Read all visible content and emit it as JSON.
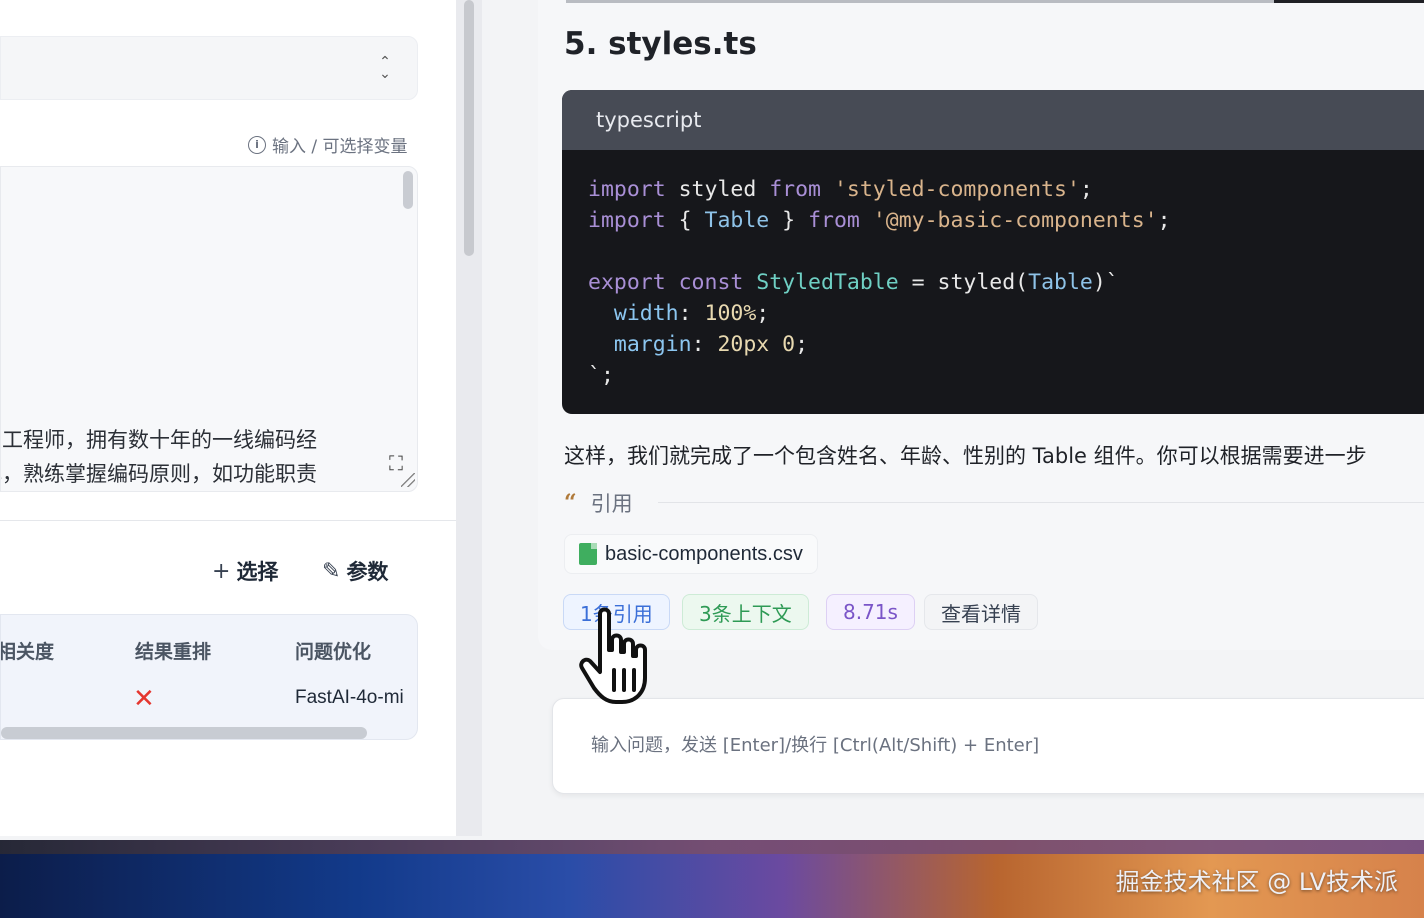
{
  "left_panel": {
    "prompt_hint": "输入 / 可选择变量",
    "prompt_lines": [
      "发工程师，拥有数十年的一线编码经",
      "解，熟练掌握编码原则，如功能职责"
    ],
    "actions": {
      "select_label": "选择",
      "params_label": "参数"
    },
    "table": {
      "headers": [
        "相关度",
        "结果重排",
        "问题优化"
      ],
      "row": {
        "rerank": "✕",
        "optimize_model": "FastAI-4o-mi"
      }
    }
  },
  "chat": {
    "heading": "5. styles.ts",
    "code": {
      "language": "typescript",
      "lines": [
        [
          [
            "kw",
            "import "
          ],
          [
            "plain",
            "styled "
          ],
          [
            "kw",
            "from "
          ],
          [
            "str",
            "'styled-components'"
          ],
          [
            "plain",
            ";"
          ]
        ],
        [
          [
            "kw",
            "import "
          ],
          [
            "plain",
            "{ "
          ],
          [
            "ty",
            "Table"
          ],
          [
            "plain",
            " } "
          ],
          [
            "kw",
            "from "
          ],
          [
            "str",
            "'@my-basic-components'"
          ],
          [
            "plain",
            ";"
          ]
        ],
        [],
        [
          [
            "kw",
            "export "
          ],
          [
            "kw",
            "const "
          ],
          [
            "fn",
            "StyledTable"
          ],
          [
            "plain",
            " = styled("
          ],
          [
            "ty",
            "Table"
          ],
          [
            "plain",
            ")`"
          ]
        ],
        [
          [
            "plain",
            "  "
          ],
          [
            "prop",
            "width"
          ],
          [
            "plain",
            ": "
          ],
          [
            "num",
            "100%"
          ],
          [
            "plain",
            ";"
          ]
        ],
        [
          [
            "plain",
            "  "
          ],
          [
            "prop",
            "margin"
          ],
          [
            "plain",
            ": "
          ],
          [
            "num",
            "20px 0"
          ],
          [
            "plain",
            ";"
          ]
        ],
        [
          [
            "plain",
            "`;"
          ]
        ]
      ]
    },
    "answer_text": "这样，我们就完成了一个包含姓名、年龄、性别的 Table 组件。你可以根据需要进一步",
    "quote_label": "引用",
    "file_name": "basic-components.csv",
    "tags": {
      "citations": "1条引用",
      "context": "3条上下文",
      "time": "8.71s",
      "details": "查看详情"
    },
    "input_placeholder": "输入问题，发送 [Enter]/换行 [Ctrl(Alt/Shift) + Enter]"
  },
  "watermark": "掘金技术社区 @ LV技术派",
  "colors": {
    "code_bg": "#16171b",
    "code_header_bg": "#474b55",
    "tag_blue": "#3b6fd8",
    "tag_green": "#2e9a55",
    "tag_purple": "#7a55c8",
    "error_red": "#e5362f"
  }
}
